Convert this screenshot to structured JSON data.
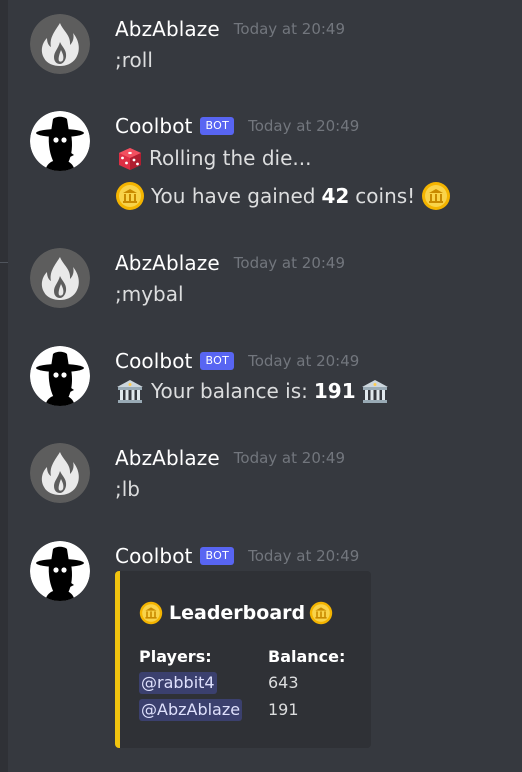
{
  "messages": [
    {
      "username": "AbzAblaze",
      "timestamp": "Today at 20:49",
      "avatar_icon": "flame-icon",
      "text": ";roll"
    },
    {
      "username": "Coolbot",
      "bot_tag": "BOT",
      "timestamp": "Today at 20:49",
      "avatar_icon": "plague-doctor-icon",
      "line1_icon": "die-icon",
      "line1": "Rolling the die...",
      "line2_icon": "coin-icon",
      "line2_prefix": "You have gained",
      "line2_amount": "42",
      "line2_suffix": "coins!"
    },
    {
      "username": "AbzAblaze",
      "timestamp": "Today at 20:49",
      "avatar_icon": "flame-icon",
      "text": ";mybal"
    },
    {
      "username": "Coolbot",
      "bot_tag": "BOT",
      "timestamp": "Today at 20:49",
      "avatar_icon": "plague-doctor-icon",
      "line_icon": "bank-icon",
      "line_prefix": "Your balance is:",
      "line_amount": "191"
    },
    {
      "username": "AbzAblaze",
      "timestamp": "Today at 20:49",
      "avatar_icon": "flame-icon",
      "text": ";lb"
    },
    {
      "username": "Coolbot",
      "bot_tag": "BOT",
      "timestamp": "Today at 20:49",
      "avatar_icon": "plague-doctor-icon",
      "embed": {
        "title_icon": "coin-icon",
        "title": "Leaderboard",
        "accent_color": "#f1c40f",
        "players_header": "Players:",
        "balance_header": "Balance:",
        "rows": [
          {
            "player": "@rabbit4",
            "balance": "643"
          },
          {
            "player": "@AbzAblaze",
            "balance": "191"
          }
        ]
      }
    }
  ]
}
